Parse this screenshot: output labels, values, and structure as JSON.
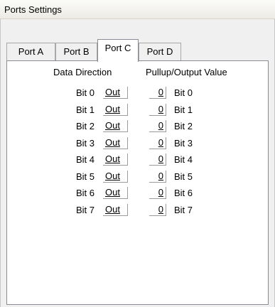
{
  "window": {
    "title": "Ports Settings"
  },
  "tabs": [
    {
      "label": "Port A",
      "selected": false
    },
    {
      "label": "Port B",
      "selected": false
    },
    {
      "label": "Port C",
      "selected": true
    },
    {
      "label": "Port D",
      "selected": false
    }
  ],
  "headers": {
    "direction": "Data Direction",
    "value": "Pullup/Output Value"
  },
  "rows": [
    {
      "left_label": "Bit 0",
      "direction": "Out",
      "value": "0",
      "right_label": "Bit 0"
    },
    {
      "left_label": "Bit 1",
      "direction": "Out",
      "value": "0",
      "right_label": "Bit 1"
    },
    {
      "left_label": "Bit 2",
      "direction": "Out",
      "value": "0",
      "right_label": "Bit 2"
    },
    {
      "left_label": "Bit 3",
      "direction": "Out",
      "value": "0",
      "right_label": "Bit 3"
    },
    {
      "left_label": "Bit 4",
      "direction": "Out",
      "value": "0",
      "right_label": "Bit 4"
    },
    {
      "left_label": "Bit 5",
      "direction": "Out",
      "value": "0",
      "right_label": "Bit 5"
    },
    {
      "left_label": "Bit 6",
      "direction": "Out",
      "value": "0",
      "right_label": "Bit 6"
    },
    {
      "left_label": "Bit 7",
      "direction": "Out",
      "value": "0",
      "right_label": "Bit 7"
    }
  ],
  "colors": {
    "panel": "#ffffff",
    "frame": "#f0f0f0",
    "border": "#898c95"
  }
}
